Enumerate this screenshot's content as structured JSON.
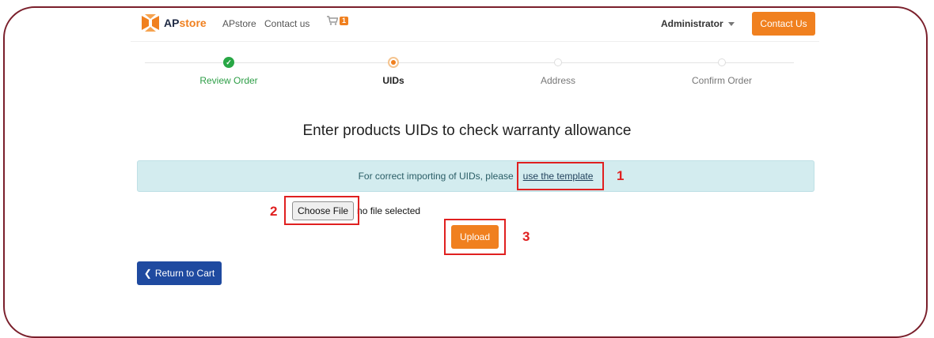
{
  "nav": {
    "logo_prefix": "AP",
    "logo_suffix": "store",
    "links": [
      "APstore",
      "Contact us"
    ],
    "cart_count": "1",
    "user_label": "Administrator",
    "contact_button": "Contact Us"
  },
  "steps": [
    {
      "label": "Review Order",
      "state": "done"
    },
    {
      "label": "UIDs",
      "state": "active"
    },
    {
      "label": "Address",
      "state": "todo"
    },
    {
      "label": "Confirm Order",
      "state": "todo"
    }
  ],
  "heading": "Enter products UIDs to check warranty allowance",
  "alert": {
    "text": "For correct importing of UIDs, please",
    "link": "use the template"
  },
  "file_input": {
    "button_label": "Choose File",
    "status": "no file selected"
  },
  "upload_button": "Upload",
  "return_button": "Return to Cart",
  "annotations": [
    "1",
    "2",
    "3"
  ],
  "colors": {
    "brand_orange": "#f0801f",
    "success_green": "#28a745",
    "primary_blue": "#1f4aa0",
    "alert_bg": "#d3ecef",
    "annotation_red": "#e02020",
    "frame_border": "#7a1f2b"
  },
  "icons": {
    "cart": "cart-icon",
    "caret": "chevron-down-icon",
    "check": "check-icon",
    "back": "chevron-left-icon"
  }
}
